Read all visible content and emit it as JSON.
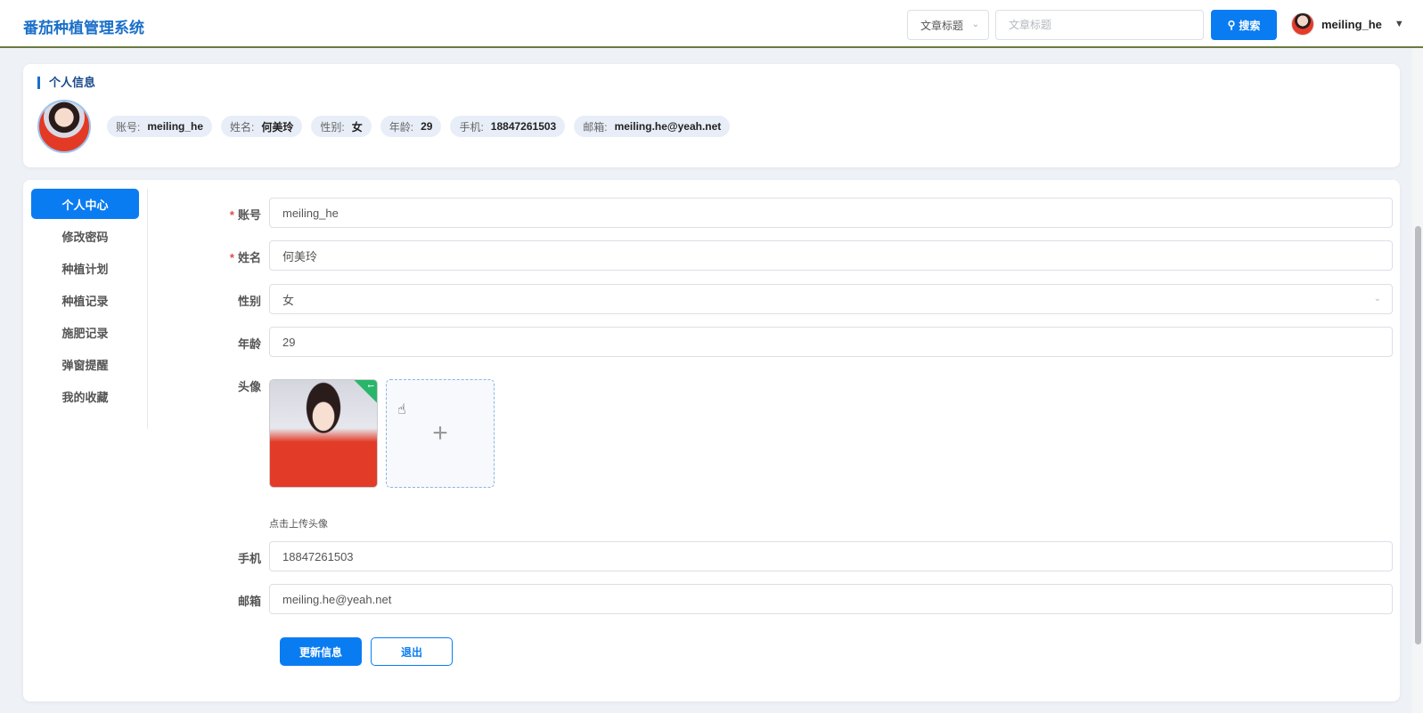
{
  "header": {
    "brand": "番茄种植管理系统",
    "search_select_value": "文章标题",
    "search_placeholder": "文章标题",
    "search_button": "搜索",
    "user_name": "meiling_he"
  },
  "info": {
    "title": "个人信息",
    "chips": [
      {
        "label": "账号:",
        "value": "meiling_he"
      },
      {
        "label": "姓名:",
        "value": "何美玲"
      },
      {
        "label": "性别:",
        "value": "女"
      },
      {
        "label": "年龄:",
        "value": "29"
      },
      {
        "label": "手机:",
        "value": "18847261503"
      },
      {
        "label": "邮箱:",
        "value": "meiling.he@yeah.net"
      }
    ]
  },
  "menu": {
    "items": [
      "个人中心",
      "修改密码",
      "种植计划",
      "种植记录",
      "施肥记录",
      "弹窗提醒",
      "我的收藏"
    ],
    "active": "个人中心"
  },
  "form": {
    "account_label": "账号",
    "account_value": "meiling_he",
    "name_label": "姓名",
    "name_value": "何美玲",
    "gender_label": "性别",
    "gender_value": "女",
    "age_label": "年龄",
    "age_value": "29",
    "avatar_label": "头像",
    "upload_hint": "点击上传头像",
    "phone_label": "手机",
    "phone_value": "18847261503",
    "email_label": "邮箱",
    "email_value": "meiling.he@yeah.net",
    "required_mark": "*"
  },
  "actions": {
    "update": "更新信息",
    "logout": "退出"
  },
  "colors": {
    "primary": "#0a7cf2",
    "brand": "#1a6fc9",
    "success": "#28b66a"
  }
}
